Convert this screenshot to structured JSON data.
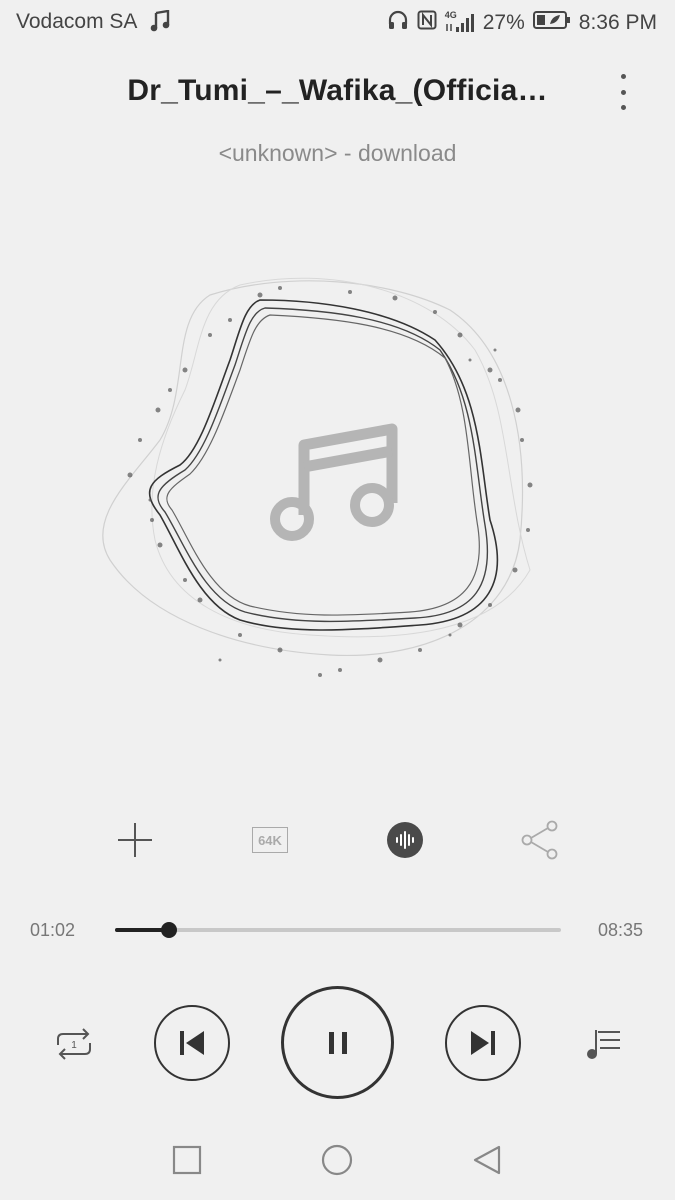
{
  "status_bar": {
    "carrier": "Vodacom SA",
    "network": "4G",
    "battery_percent": "27%",
    "time": "8:36 PM",
    "icons": [
      "music-note-icon",
      "headphones-icon",
      "nfc-icon",
      "signal-icon",
      "battery-icon"
    ]
  },
  "header": {
    "title": "Dr_Tumi_–_Wafika_(Officia…",
    "subtitle": "<unknown> - download",
    "menu_icon": "more-vertical-icon"
  },
  "artwork": {
    "icon": "music-note-icon"
  },
  "actions": {
    "add_icon": "plus-icon",
    "quality_label": "64K",
    "sound_effect_icon": "audio-wave-icon",
    "share_icon": "share-icon"
  },
  "progress": {
    "current": "01:02",
    "total": "08:35",
    "fraction": 0.12
  },
  "controls": {
    "repeat_icon": "repeat-one-icon",
    "prev_icon": "skip-previous-icon",
    "play_state_icon": "pause-icon",
    "next_icon": "skip-next-icon",
    "playlist_icon": "playlist-icon"
  },
  "nav": {
    "recent_icon": "square-icon",
    "home_icon": "circle-icon",
    "back_icon": "triangle-back-icon"
  },
  "colors": {
    "background": "#f0f0f0",
    "accent": "#222222",
    "muted": "#8a8a8a"
  }
}
